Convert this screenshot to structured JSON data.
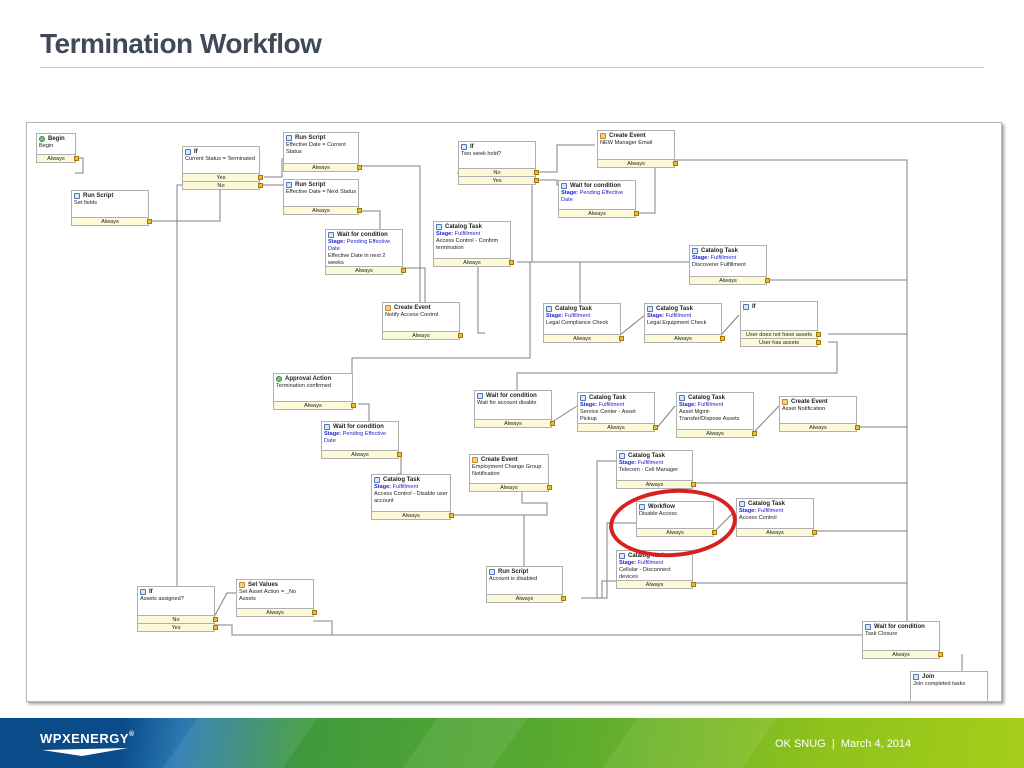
{
  "slide": {
    "title": "Termination Workflow",
    "footer_org": "OK SNUG",
    "footer_sep": "|",
    "footer_date": "March 4, 2014",
    "logo_text": "WPXENERGY",
    "logo_mark": "®"
  },
  "colors": {
    "footer_blue": "#0a4b8a",
    "footer_green": "#8ec21c",
    "highlight": "#d82020",
    "stage_text": "#2222cc",
    "condition_bg": "#fbf9d8"
  },
  "nodes": {
    "begin": {
      "icon": "begin-icon",
      "title": "Begin",
      "body": "Begin",
      "out": "Always"
    },
    "run_script_set_fields": {
      "icon": "script-icon",
      "title": "Run Script",
      "body": "Set fields",
      "out": "Always"
    },
    "if_status": {
      "icon": "if-icon",
      "title": "If",
      "body": "Current Status = Terminated",
      "yes": "Yes",
      "no": "No"
    },
    "run_script_current": {
      "icon": "script-icon",
      "title": "Run Script",
      "body": "Effective Date = Current Status",
      "out": "Always"
    },
    "run_script_next": {
      "icon": "script-icon",
      "title": "Run Script",
      "body": "Effective Date = Next Status",
      "out": "Always"
    },
    "wait_effective_2wk": {
      "icon": "wait-icon",
      "title": "Wait for condition",
      "stage_label": "Stage:",
      "stage": "Pending Effective Date",
      "body": "Effective Date in next 2 weeks",
      "out": "Always"
    },
    "create_event_notify": {
      "icon": "event-icon",
      "title": "Create Event",
      "body": "Notify Access Control",
      "out": "Always"
    },
    "catalog_confirm": {
      "icon": "catalog-icon",
      "title": "Catalog Task",
      "stage_label": "Stage:",
      "stage": "Fulfillment",
      "body": "Access Control - Confirm termination",
      "out": "Always"
    },
    "if_two_week": {
      "icon": "if-icon",
      "title": "If",
      "body": "Two week hold?",
      "no": "No",
      "yes": "Yes"
    },
    "create_event_manager": {
      "icon": "event-icon",
      "title": "Create Event",
      "body": "NEW Manager Email",
      "out": "Always"
    },
    "wait_effective": {
      "icon": "wait-icon",
      "title": "Wait for condition",
      "stage_label": "Stage:",
      "stage": "Pending Effective Date",
      "body": "",
      "out": "Always"
    },
    "catalog_discover": {
      "icon": "catalog-icon",
      "title": "Catalog Task",
      "stage_label": "Stage:",
      "stage": "Fulfillment",
      "body": "Discoverer Fulfillment",
      "out": "Always"
    },
    "catalog_legal_compliance": {
      "icon": "catalog-icon",
      "title": "Catalog Task",
      "stage_label": "Stage:",
      "stage": "Fulfillment",
      "body": "Legal Compliance Check",
      "out": "Always"
    },
    "catalog_legal_equipment": {
      "icon": "catalog-icon",
      "title": "Catalog Task",
      "stage_label": "Stage:",
      "stage": "Fulfillment",
      "body": "Legal Equipment Check",
      "out": "Always"
    },
    "if_assets": {
      "icon": "if-icon",
      "title": "If",
      "body": "",
      "a": "User does not have assets",
      "b": "User has assets"
    },
    "approval": {
      "icon": "approval-icon",
      "title": "Approval Action",
      "body": "Termination confirmed",
      "out": "Always"
    },
    "wait_account_disable": {
      "icon": "wait-icon",
      "title": "Wait for condition",
      "body": "Wait for account disable",
      "out": "Always"
    },
    "catalog_service_center": {
      "icon": "catalog-icon",
      "title": "Catalog Task",
      "stage_label": "Stage:",
      "stage": "Fulfillment",
      "body": "Service Center - Asset Pickup",
      "out": "Always"
    },
    "catalog_asset_mgmt": {
      "icon": "catalog-icon",
      "title": "Catalog Task",
      "stage_label": "Stage:",
      "stage": "Fulfillment",
      "body": "Asset Mgmt- Transfer/Dispose Assets",
      "out": "Always"
    },
    "create_event_asset": {
      "icon": "event-icon",
      "title": "Create Event",
      "body": "Asset Notification",
      "out": "Always"
    },
    "wait_effective_2": {
      "icon": "wait-icon",
      "title": "Wait for condition",
      "stage_label": "Stage:",
      "stage": "Pending Effective Date",
      "body": "",
      "out": "Always"
    },
    "catalog_disable_user": {
      "icon": "catalog-icon",
      "title": "Catalog Task",
      "stage_label": "Stage:",
      "stage": "Fulfillment",
      "body": "Access Control - Disable user account",
      "out": "Always"
    },
    "create_event_employment": {
      "icon": "event-icon",
      "title": "Create Event",
      "body": "Employment Change Group Notification",
      "out": "Always"
    },
    "catalog_telecom": {
      "icon": "catalog-icon",
      "title": "Catalog Task",
      "stage_label": "Stage:",
      "stage": "Fulfillment",
      "body": "Telecom - Cell Manager",
      "out": "Always"
    },
    "workflow_disable": {
      "icon": "workflow-icon",
      "title": "Workflow",
      "body": "Disable Access",
      "out": "Always"
    },
    "catalog_access_control": {
      "icon": "catalog-icon",
      "title": "Catalog Task",
      "stage_label": "Stage:",
      "stage": "Fulfillment",
      "body": "Access Control",
      "out": "Always"
    },
    "catalog_cellular": {
      "icon": "catalog-icon",
      "title": "Catalog Task",
      "stage_label": "Stage:",
      "stage": "Fulfillment",
      "body": "Cellular - Disconnect devices",
      "out": "Always"
    },
    "run_script_disabled": {
      "icon": "script-icon",
      "title": "Run Script",
      "body": "Account is disabled",
      "out": "Always"
    },
    "if_assets_assigned": {
      "icon": "if-icon",
      "title": "If",
      "body": "Assets assigned?",
      "no": "No",
      "yes": "Yes"
    },
    "set_values": {
      "icon": "setvalues-icon",
      "title": "Set Values",
      "body": "Set Asset Action = _No Assets",
      "out": "Always"
    },
    "wait_task_closure": {
      "icon": "wait-icon",
      "title": "Wait for condition",
      "body": "Task Closure",
      "out": "Always"
    },
    "join": {
      "icon": "join-icon",
      "title": "Join",
      "body": "Join completed tasks"
    }
  }
}
